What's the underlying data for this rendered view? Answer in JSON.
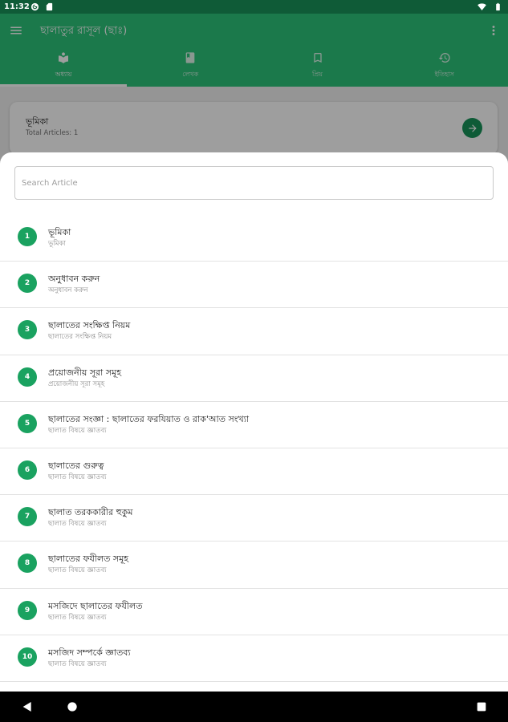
{
  "colors": {
    "status_bar": "#0f5b37",
    "primary": "#2cc47a",
    "accent_dark": "#17935a",
    "badge": "#1aa260"
  },
  "status_bar": {
    "time": "11:32",
    "left_icons": [
      "notification-icon",
      "sd-card-icon"
    ],
    "right_icons": [
      "wifi-icon",
      "battery-icon"
    ]
  },
  "app_bar": {
    "title": "ছালাতুর রাসূল (ছাঃ)",
    "menu_icon": "menu-icon",
    "overflow_icon": "more-vert-icon"
  },
  "tabs": [
    {
      "label": "অধ্যায়",
      "icon": "local-library-icon",
      "selected": true
    },
    {
      "label": "লেখক",
      "icon": "book-icon",
      "selected": false
    },
    {
      "label": "প্রিয়",
      "icon": "bookmark-icon",
      "selected": false
    },
    {
      "label": "ইতিহাস",
      "icon": "history-icon",
      "selected": false
    }
  ],
  "background_card": {
    "title": "ভূমিকা",
    "subtitle": "Total Articles: 1",
    "action_icon": "arrow-forward-icon"
  },
  "sheet": {
    "search": {
      "placeholder": "Search Article",
      "value": ""
    },
    "articles": [
      {
        "number": "1",
        "title": "ভূমিকা",
        "subtitle": "ভূমিকা"
      },
      {
        "number": "2",
        "title": "অনুধাবন করুন",
        "subtitle": "অনুধাবন করুন"
      },
      {
        "number": "3",
        "title": "ছালাতের সংক্ষিপ্ত নিয়ম",
        "subtitle": "ছালাতের সংক্ষিপ্ত নিয়ম"
      },
      {
        "number": "4",
        "title": "প্রয়োজনীয় সূরা সমূহ",
        "subtitle": "প্রয়োজনীয় সূরা সমূহ"
      },
      {
        "number": "5",
        "title": "ছালাতের সংজ্ঞা : ছালাতের ফরযিয়াত ও রাক'আত সংখ্যা",
        "subtitle": "ছালাত বিষয়ে জ্ঞাতব্য"
      },
      {
        "number": "6",
        "title": "ছালাতের গুরুত্ব",
        "subtitle": "ছালাত বিষয়ে জ্ঞাতব্য"
      },
      {
        "number": "7",
        "title": "ছালাত তরককারীর হুকুম",
        "subtitle": "ছালাত বিষয়ে জ্ঞাতব্য"
      },
      {
        "number": "8",
        "title": "ছালাতের ফযীলত সমূহ",
        "subtitle": "ছালাত বিষয়ে জ্ঞাতব্য"
      },
      {
        "number": "9",
        "title": "মসজিদে ছালাতের ফযীলত",
        "subtitle": "ছালাত বিষয়ে জ্ঞাতব্য"
      },
      {
        "number": "10",
        "title": "মসজিদ সম্পর্কে জ্ঞাতব্য",
        "subtitle": "ছালাত বিষয়ে জ্ঞাতব্য"
      }
    ]
  },
  "nav_bar": {
    "buttons": [
      "back-icon",
      "home-icon",
      "recents-icon"
    ]
  }
}
